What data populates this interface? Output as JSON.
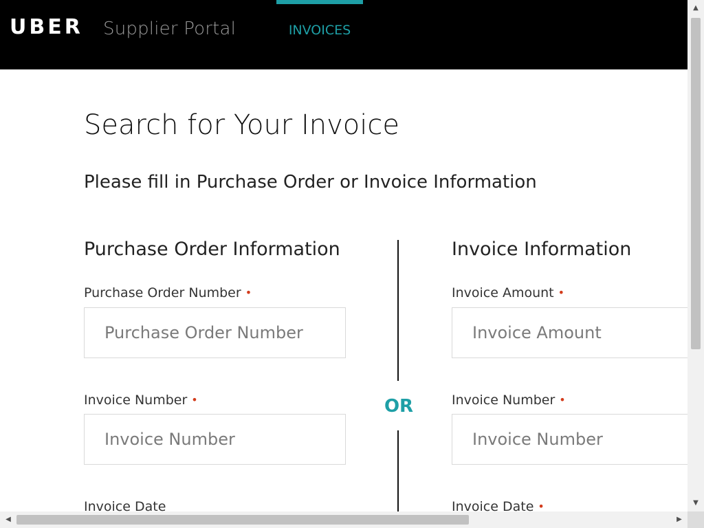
{
  "header": {
    "logo": "UBER",
    "portal_name": "Supplier Portal",
    "nav_tab": "INVOICES"
  },
  "page": {
    "title": "Search for Your Invoice",
    "subtitle": "Please fill in Purchase Order or Invoice Information"
  },
  "purchase_order_section": {
    "title": "Purchase Order Information",
    "fields": [
      {
        "label": "Purchase Order Number",
        "placeholder": "Purchase Order Number",
        "required": true
      },
      {
        "label": "Invoice Number",
        "placeholder": "Invoice Number",
        "required": true
      },
      {
        "label": "Invoice Date",
        "required": false
      }
    ]
  },
  "divider": {
    "label": "OR"
  },
  "invoice_section": {
    "title": "Invoice Information",
    "fields": [
      {
        "label": "Invoice Amount",
        "placeholder": "Invoice Amount",
        "required": true
      },
      {
        "label": "Invoice Number",
        "placeholder": "Invoice Number",
        "required": true
      },
      {
        "label": "Invoice Date",
        "required": true
      }
    ]
  },
  "required_marker": "•",
  "colors": {
    "accent": "#1e9fa6",
    "header_bg": "#000000",
    "required": "#d33c1c"
  },
  "icons": {
    "scroll_up": "triangle-up-icon",
    "scroll_down": "triangle-down-icon",
    "scroll_left": "triangle-left-icon",
    "scroll_right": "triangle-right-icon"
  }
}
